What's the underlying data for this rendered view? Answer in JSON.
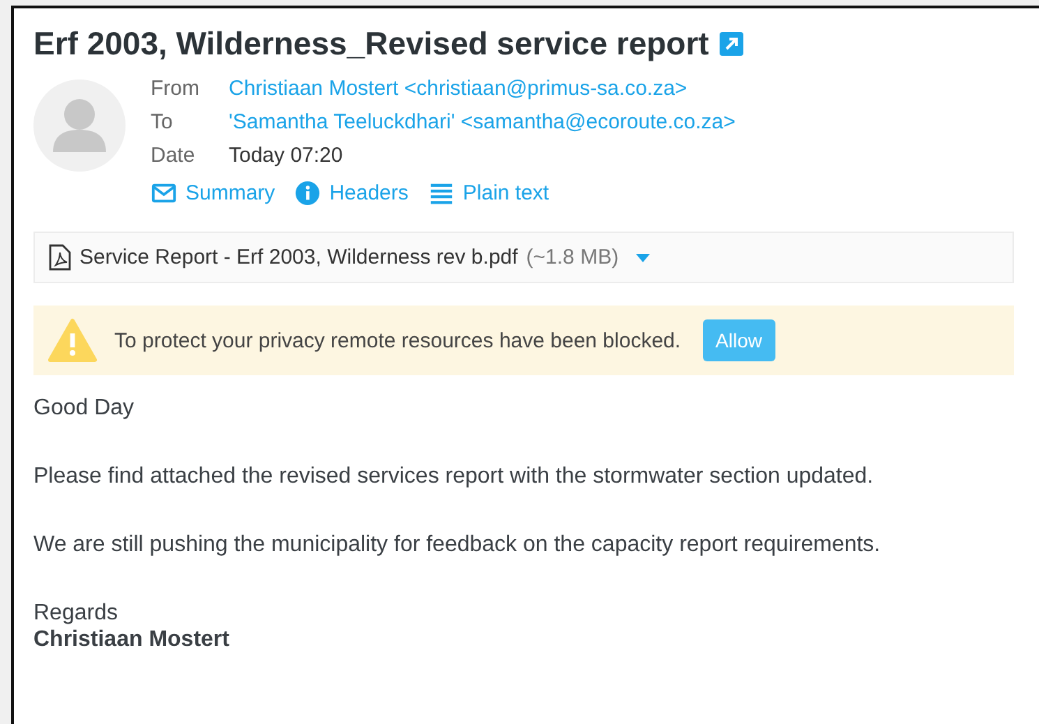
{
  "subject": "Erf 2003, Wilderness_Revised service report",
  "headers": [
    {
      "label": "From",
      "value": "Christiaan Mostert <christiaan@primus-sa.co.za>",
      "kind": "link"
    },
    {
      "label": "To",
      "value": "'Samantha Teeluckdhari' <samantha@ecoroute.co.za>",
      "kind": "link"
    },
    {
      "label": "Date",
      "value": "Today 07:20",
      "kind": "text"
    }
  ],
  "view_links": [
    {
      "label": "Summary",
      "kind": "envelope"
    },
    {
      "label": "Headers",
      "kind": "info"
    },
    {
      "label": "Plain text",
      "kind": "lines"
    }
  ],
  "attachment": {
    "name": "Service Report - Erf 2003, Wilderness rev b.pdf",
    "size": "(~1.8 MB)"
  },
  "notice": {
    "text": "To protect your privacy remote resources have been blocked.",
    "button": "Allow"
  },
  "body": [
    "Good Day",
    "Please find attached the revised services report with the stormwater section updated.",
    "We are still pushing the municipality for feedback on the capacity report requirements."
  ],
  "closing": "Regards",
  "signature": "Christiaan Mostert"
}
